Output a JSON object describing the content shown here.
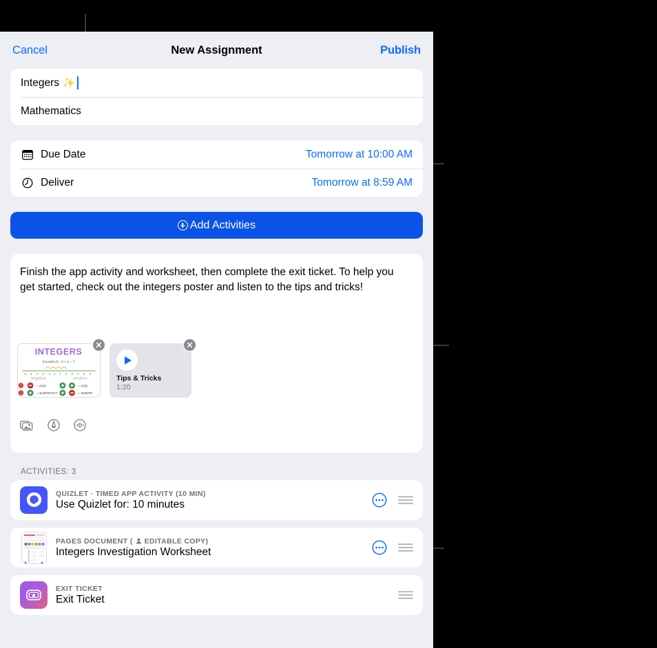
{
  "nav": {
    "cancel_label": "Cancel",
    "title": "New Assignment",
    "publish_label": "Publish"
  },
  "form": {
    "title_value": "Integers",
    "title_emoji": "✨",
    "subject_value": "Mathematics"
  },
  "schedule": {
    "rows": [
      {
        "icon": "calendar-icon",
        "label": "Due Date",
        "value": "Tomorrow at 10:00 AM"
      },
      {
        "icon": "clock-icon",
        "label": "Deliver",
        "value": "Tomorrow at 8:59 AM"
      }
    ]
  },
  "add_activities": {
    "label": "Add Activities",
    "icon": "plus-circle-icon",
    "accent": "#0b53e8"
  },
  "instructions": {
    "text": "Finish the app activity and worksheet, then complete the exit ticket. To help you get started, check out the integers poster and listen to the tips and tricks!",
    "attachments": [
      {
        "kind": "image",
        "name": "integers-poster",
        "poster_title": "INTEGERS",
        "poster_example": "EXAMPLE:  -3 + 4 = ?",
        "poster_left_label": "negative",
        "poster_right_label": "positive",
        "poster_rows": [
          {
            "left_sign": "minus",
            "left_op": "ADD",
            "mid_sign": "plus",
            "right_sign": "plus",
            "right_op": "ADD"
          },
          {
            "left_sign": "plus",
            "left_op": "SUBTRACT",
            "mid_sign": "plus",
            "right_sign": "minus",
            "right_op": "SUBTRACT"
          }
        ],
        "close_icon": "close-icon"
      },
      {
        "kind": "audio",
        "name": "tips-and-tricks-audio",
        "title": "Tips & Tricks",
        "duration": "1:20",
        "play_icon": "play-icon",
        "close_icon": "close-icon"
      }
    ],
    "tools": [
      {
        "icon": "photo-library-icon",
        "name": "insert-photo-button"
      },
      {
        "icon": "markup-pen-icon",
        "name": "markup-button"
      },
      {
        "icon": "audio-record-icon",
        "name": "record-audio-button"
      }
    ]
  },
  "activities": {
    "header": "ACTIVITIES: 3",
    "count": 3,
    "items": [
      {
        "thumb": "quizlet-app-icon",
        "kicker": "QUIZLET · TIMED APP ACTIVITY (10 MIN)",
        "name": "Use Quizlet for: 10 minutes",
        "has_more": true,
        "more_icon": "more-circle-icon",
        "grip_icon": "reorder-grip-icon",
        "editable_copy": false
      },
      {
        "thumb": "pages-document-thumbnail",
        "kicker": "PAGES DOCUMENT  (",
        "kicker_badge": "EDITABLE COPY)",
        "name": "Integers Investigation Worksheet",
        "has_more": true,
        "more_icon": "more-circle-icon",
        "grip_icon": "reorder-grip-icon",
        "editable_copy": true
      },
      {
        "thumb": "exit-ticket-icon",
        "kicker": "EXIT TICKET",
        "name": "Exit Ticket",
        "has_more": false,
        "grip_icon": "reorder-grip-icon",
        "editable_copy": false
      }
    ]
  },
  "colors": {
    "accent_blue": "#0b6cff",
    "button_blue": "#0b53e8",
    "sheet_bg": "#eeeef5",
    "callout": "#3a3a3c"
  }
}
